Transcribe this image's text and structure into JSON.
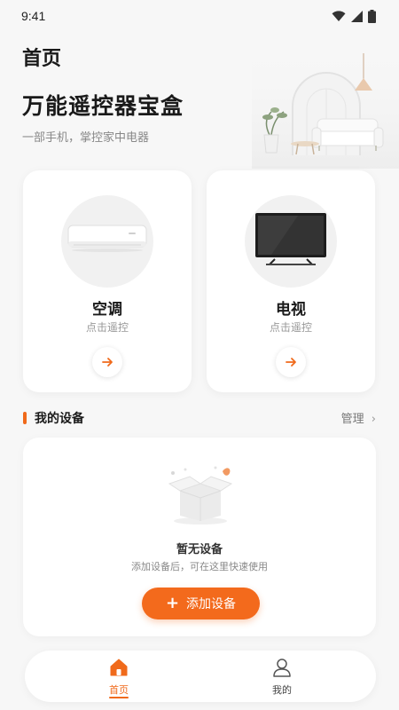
{
  "status_bar": {
    "time": "9:41"
  },
  "header": {
    "page_title": "首页",
    "hero_title": "万能遥控器宝盒",
    "hero_subtitle": "一部手机，掌控家中电器"
  },
  "device_cards": [
    {
      "name": "空调",
      "hint": "点击遥控",
      "icon": "air-conditioner"
    },
    {
      "name": "电视",
      "hint": "点击遥控",
      "icon": "television"
    }
  ],
  "my_devices": {
    "title": "我的设备",
    "manage_label": "管理",
    "empty_title": "暂无设备",
    "empty_desc": "添加设备后，可在这里快速使用",
    "add_label": "添加设备"
  },
  "bottom_nav": [
    {
      "label": "首页",
      "icon": "home-icon",
      "active": true
    },
    {
      "label": "我的",
      "icon": "user-icon",
      "active": false
    }
  ],
  "colors": {
    "accent": "#f06a1b",
    "background": "#f7f7f7",
    "card": "#ffffff"
  }
}
